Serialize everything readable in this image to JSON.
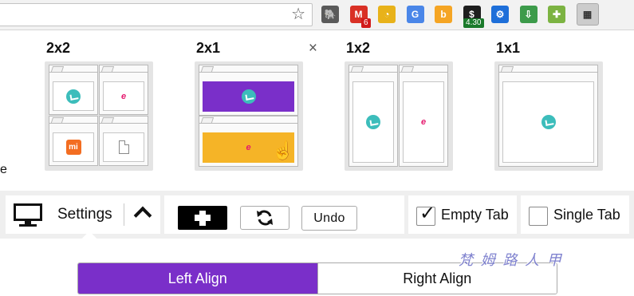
{
  "toolbar": {
    "bookmark_icon": "star-icon",
    "extensions": [
      {
        "name": "evernote-icon",
        "color": "#5a5a5a",
        "glyph": "🐘"
      },
      {
        "name": "gmail-icon",
        "color": "#d93025",
        "glyph": "M",
        "badge": "6"
      },
      {
        "name": "clock-extension-icon",
        "color": "#e8b21a",
        "glyph": "◔"
      },
      {
        "name": "translate-icon",
        "color": "#4a86e8",
        "glyph": "G"
      },
      {
        "name": "b-extension-icon",
        "color": "#f5a524",
        "glyph": "b"
      },
      {
        "name": "dollar-extension-icon",
        "color": "#1e1e1e",
        "glyph": "$",
        "badge": "4.30"
      },
      {
        "name": "settings-gear-ext-icon",
        "color": "#1e6fd9",
        "glyph": "⚙"
      },
      {
        "name": "download-extension-icon",
        "color": "#3d9b4b",
        "glyph": "⇩"
      },
      {
        "name": "puzzle-extension-icon",
        "color": "#7cb342",
        "glyph": "✚"
      },
      {
        "name": "tab-layout-extension-icon",
        "color": "#cccccc",
        "glyph": "▦"
      }
    ]
  },
  "layouts": [
    {
      "title": "2x2",
      "id": "2x2"
    },
    {
      "title": "2x1",
      "id": "2x1"
    },
    {
      "title": "1x2",
      "id": "1x2"
    },
    {
      "title": "1x1",
      "id": "1x1"
    }
  ],
  "close_glyph": "×",
  "controls": {
    "settings_label": "Settings",
    "undo_label": "Undo",
    "empty_tab_label": "Empty Tab",
    "empty_tab_checked": true,
    "single_tab_label": "Single Tab",
    "single_tab_checked": false,
    "check_glyph": "✓"
  },
  "align": {
    "left_label": "Left Align",
    "right_label": "Right Align",
    "selected": "left"
  },
  "colors": {
    "accent_purple": "#7a2fc9",
    "accent_orange": "#f5b427",
    "teal": "#3cbdbb"
  },
  "watermark": "梵 姆 路 人 甲",
  "left_edge_glyph": "e"
}
